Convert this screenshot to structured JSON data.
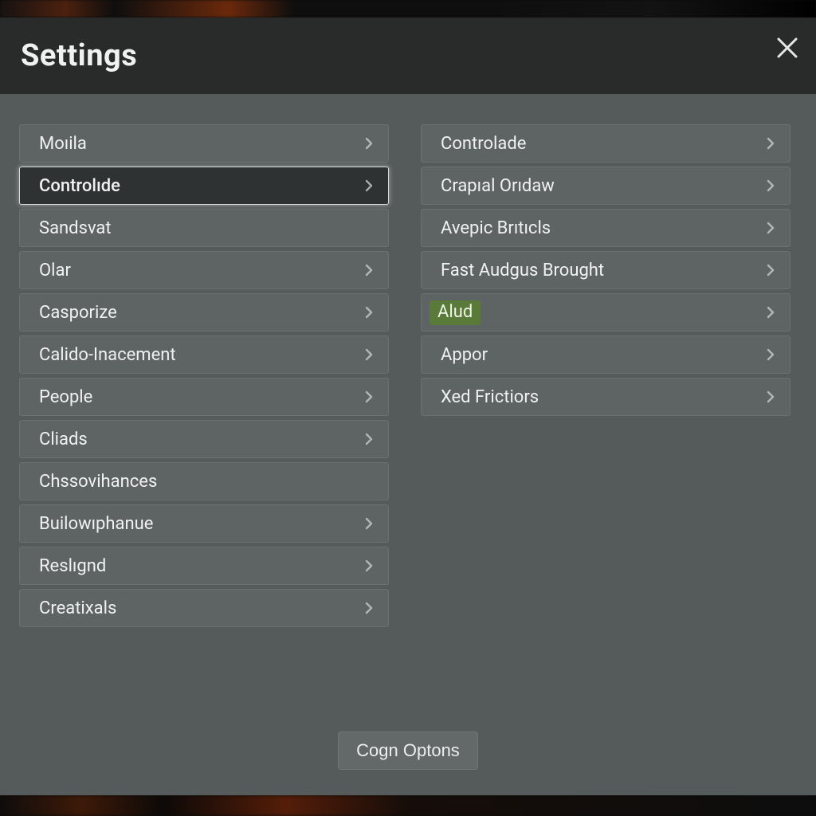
{
  "header": {
    "title": "Settings"
  },
  "left": {
    "items": [
      {
        "label": "Moıila",
        "chev": true,
        "selected": false
      },
      {
        "label": "Controlıde",
        "chev": true,
        "selected": true
      },
      {
        "label": "Sandsvat",
        "chev": false,
        "selected": false
      },
      {
        "label": "Olar",
        "chev": true,
        "selected": false
      },
      {
        "label": "Casporize",
        "chev": true,
        "selected": false
      },
      {
        "label": "Calido-Inacement",
        "chev": true,
        "selected": false
      },
      {
        "label": "People",
        "chev": true,
        "selected": false
      },
      {
        "label": "Cliads",
        "chev": true,
        "selected": false
      },
      {
        "label": "Chssovihances",
        "chev": false,
        "selected": false
      },
      {
        "label": "Builowıphanue",
        "chev": true,
        "selected": false
      },
      {
        "label": "Reslıgnd",
        "chev": true,
        "selected": false
      },
      {
        "label": "Creatixals",
        "chev": true,
        "selected": false
      }
    ]
  },
  "right": {
    "items": [
      {
        "label": "Controlade",
        "chev": true,
        "pill": false
      },
      {
        "label": "Crapıal Orıdaw",
        "chev": true,
        "pill": false
      },
      {
        "label": "Avepic Brıtıcls",
        "chev": true,
        "pill": false
      },
      {
        "label": "Fast Audgus Brought",
        "chev": true,
        "pill": false
      },
      {
        "label": "Alud",
        "chev": true,
        "pill": true
      },
      {
        "label": "Appor",
        "chev": true,
        "pill": false
      },
      {
        "label": "Xed Frictiors",
        "chev": true,
        "pill": false
      }
    ]
  },
  "footer": {
    "button_label": "Cogn Optons"
  }
}
